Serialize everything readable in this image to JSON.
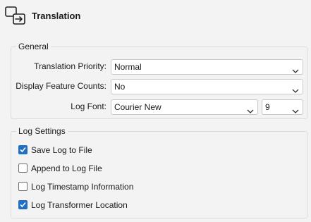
{
  "header": {
    "title": "Translation",
    "icon": "translate-icon"
  },
  "general": {
    "title": "General",
    "translation_priority": {
      "label": "Translation Priority:",
      "value": "Normal"
    },
    "display_feature_counts": {
      "label": "Display Feature Counts:",
      "value": "No"
    },
    "log_font": {
      "label": "Log Font:",
      "value": "Courier New",
      "size": "9"
    }
  },
  "log_settings": {
    "title": "Log Settings",
    "options": [
      {
        "label": "Save Log to File",
        "checked": true
      },
      {
        "label": "Append to Log File",
        "checked": false
      },
      {
        "label": "Log Timestamp Information",
        "checked": false
      },
      {
        "label": "Log Transformer Location",
        "checked": true
      }
    ]
  },
  "colors": {
    "accent": "#1f6fc5",
    "background": "#f3f3f3",
    "border": "#c9c9c9"
  }
}
